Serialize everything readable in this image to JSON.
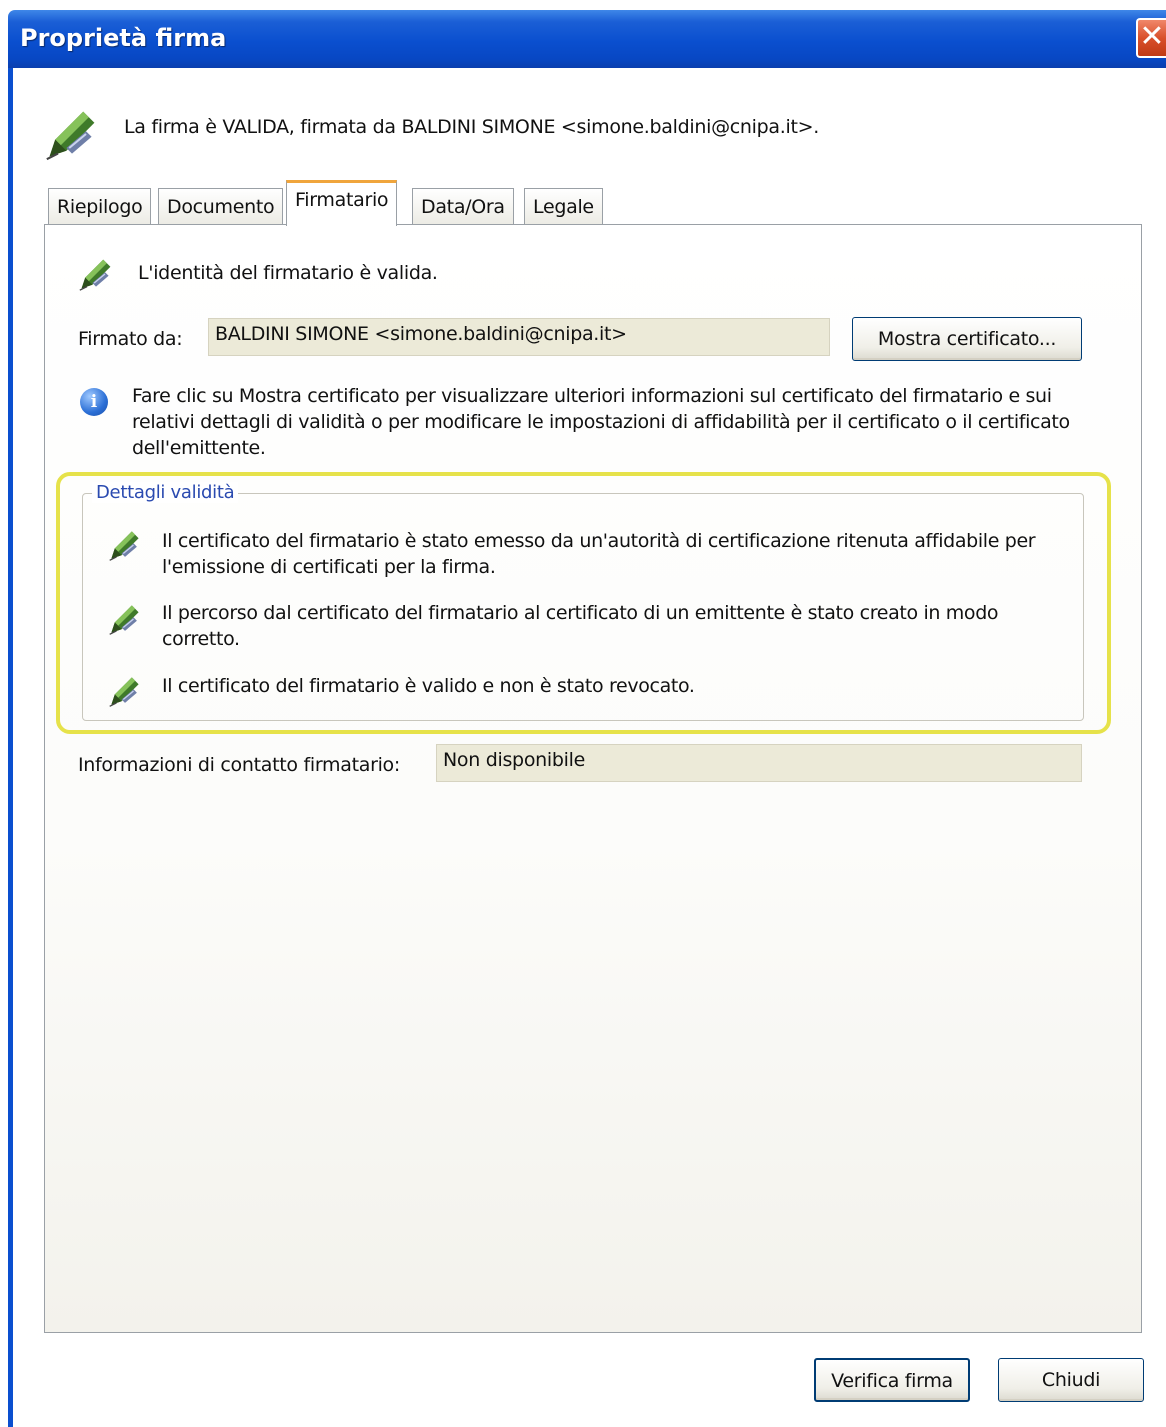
{
  "window": {
    "title": "Proprietà firma",
    "close_symbol": "✕"
  },
  "header": {
    "message": "La firma è VALIDA, firmata da BALDINI SIMONE <simone.baldini@cnipa.it>.",
    "icon": "signature-valid-icon"
  },
  "tabs": [
    {
      "label": "Riepilogo",
      "active": false
    },
    {
      "label": "Documento",
      "active": false
    },
    {
      "label": "Firmatario",
      "active": true
    },
    {
      "label": "Data/Ora",
      "active": false
    },
    {
      "label": "Legale",
      "active": false
    }
  ],
  "signer": {
    "identity_status": "L'identità del firmatario è valida.",
    "signed_by_label": "Firmato da:",
    "signed_by_value": "BALDINI SIMONE <simone.baldini@cnipa.it>",
    "show_certificate_label": "Mostra certificato...",
    "info_text": "Fare clic su Mostra certificato per visualizzare ulteriori informazioni sul certificato del firmatario e sui relativi dettagli di validità o per modificare le impostazioni di affidabilità per il certificato o il certificato dell'emittente."
  },
  "validity": {
    "legend": "Dettagli validità",
    "items": [
      "Il certificato del firmatario è stato emesso da un'autorità di certificazione ritenuta affidabile per l'emissione di certificati per la firma.",
      "Il percorso dal certificato del firmatario al certificato di un emittente è stato creato in modo corretto.",
      "Il certificato del firmatario è valido e non è stato revocato."
    ],
    "highlight_color": "#e6e24a"
  },
  "contact": {
    "label": "Informazioni di contatto firmatario:",
    "value": "Non disponibile"
  },
  "footer": {
    "verify_label": "Verifica firma",
    "close_label": "Chiudi"
  },
  "colors": {
    "titlebar": "#0a4fcf",
    "active_tab_accent": "#f0a53c",
    "field_background": "#ecead8"
  }
}
